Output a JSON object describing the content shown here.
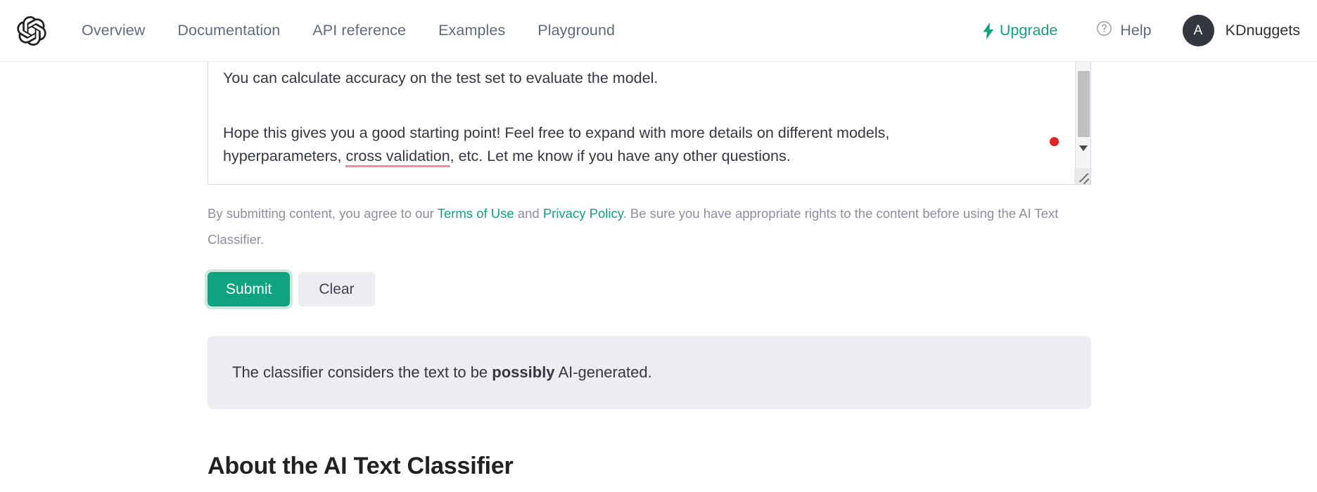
{
  "header": {
    "logo_alt": "openai-logo",
    "nav": [
      {
        "label": "Overview"
      },
      {
        "label": "Documentation"
      },
      {
        "label": "API reference"
      },
      {
        "label": "Examples"
      },
      {
        "label": "Playground"
      }
    ],
    "upgrade_label": "Upgrade",
    "help_label": "Help",
    "avatar_initial": "A",
    "username": "KDnuggets",
    "accent_color": "#10a37f",
    "avatar_color": "#353740"
  },
  "textarea": {
    "line1": "You can calculate accuracy on the test set to evaluate the model.",
    "line2": "Hope this gives you a good starting point! Feel free to expand with more details on different models,",
    "line3_pre": "hyperparameters, ",
    "line3_misspelled": "cross validation",
    "line3_post": ", etc. Let me know if you have any other questions.",
    "cursor_marker_color": "#e02424",
    "spellcheck_underline_color": "#f08a96"
  },
  "terms": {
    "part1": "By submitting content, you agree to our ",
    "link1": "Terms of Use",
    "part2": " and ",
    "link2": "Privacy Policy",
    "part3": ". Be sure you have appropriate rights to the content before using the AI Text Classifier.",
    "link_color": "#10a37f"
  },
  "actions": {
    "submit_label": "Submit",
    "clear_label": "Clear"
  },
  "result": {
    "prefix": "The classifier considers the text to be ",
    "verdict": "possibly",
    "suffix": " AI-generated."
  },
  "about": {
    "heading": "About the AI Text Classifier"
  }
}
